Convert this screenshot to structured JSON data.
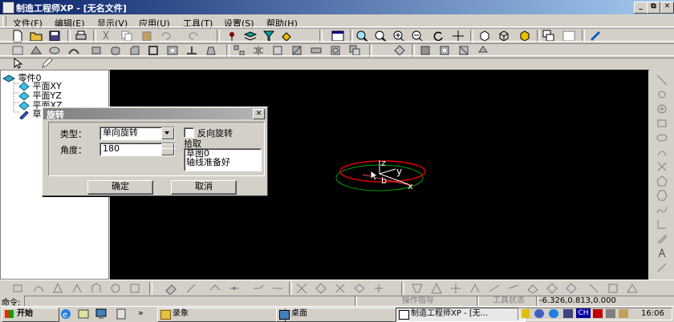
{
  "window": {
    "title": "制造工程师XP - [无名文件]",
    "buttons": [
      "_",
      "⧉",
      "✕"
    ]
  },
  "menu": [
    "文件(F)",
    "编辑(E)",
    "显示(V)",
    "应用(U)",
    "工具(T)",
    "设置(S)",
    "帮助(H)"
  ],
  "tree": {
    "root": "零件0",
    "children": [
      "平面XY",
      "平面YZ",
      "平面XZ",
      "草"
    ]
  },
  "dialog": {
    "title": "旋转",
    "close": "✕",
    "type_label": "类型：",
    "type_value": "单向旋转",
    "angle_label": "角度：",
    "angle_value": "180",
    "reverse_label": "反向旋转",
    "pick_label": "拾取",
    "pick_lines": [
      "草图0",
      "轴线准备好"
    ],
    "ok": "确定",
    "cancel": "取消"
  },
  "viewport": {
    "axis_labels": {
      "z": "z",
      "y": "y",
      "x": "x"
    },
    "point_label": "b"
  },
  "status": {
    "command_label": "命令:",
    "prompt": "操作指导",
    "tool_state": "工具状态",
    "coords": "-6.326,0.813,0.000"
  },
  "taskbar": {
    "start": "开始",
    "chevron": "»",
    "items": [
      "录象",
      "桌面",
      "制造工程师XP - [无..."
    ],
    "lang": "CH",
    "clock": "16:06"
  },
  "colors": {
    "title_active": "#0a246a",
    "canvas": "#000000",
    "ellipse_red": "#e00000",
    "ellipse_green": "#00a000"
  }
}
